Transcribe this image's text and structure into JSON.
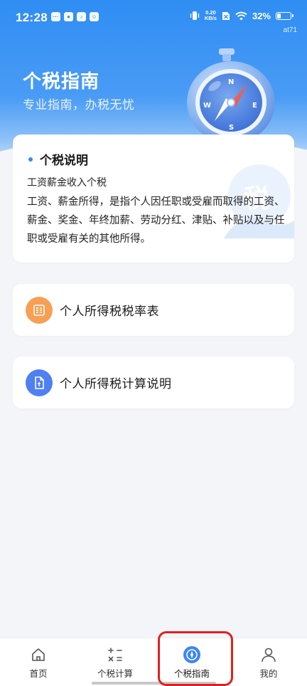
{
  "status_bar": {
    "time": "12:28",
    "net_speed_value": "0.20",
    "net_speed_unit": "KB/s",
    "battery": "32%",
    "battery_level": 0.32,
    "watermark": "at71"
  },
  "hero": {
    "title": "个税指南",
    "subtitle": "专业指南，办税无忧"
  },
  "info_card": {
    "title": "个税说明",
    "subtitle": "工资薪金收入个税",
    "body": "工资、薪金所得，是指个人因任职或受雇而取得的工资、薪金、奖金、年终加薪、劳动分红、津贴、补贴以及与任职或受雇有关的其他所得。",
    "watermark_char": "税"
  },
  "links": {
    "rate_table": "个人所得税税率表",
    "calc_guide": "个人所得税计算说明"
  },
  "bottom_nav": {
    "home": "首页",
    "calculator": "个税计算",
    "guide": "个税指南",
    "mine": "我的"
  },
  "colors": {
    "brand_blue": "#2f8df3",
    "orange_icon": "#f7a054",
    "blue_icon": "#4f7ff2",
    "highlight": "#e02020"
  }
}
